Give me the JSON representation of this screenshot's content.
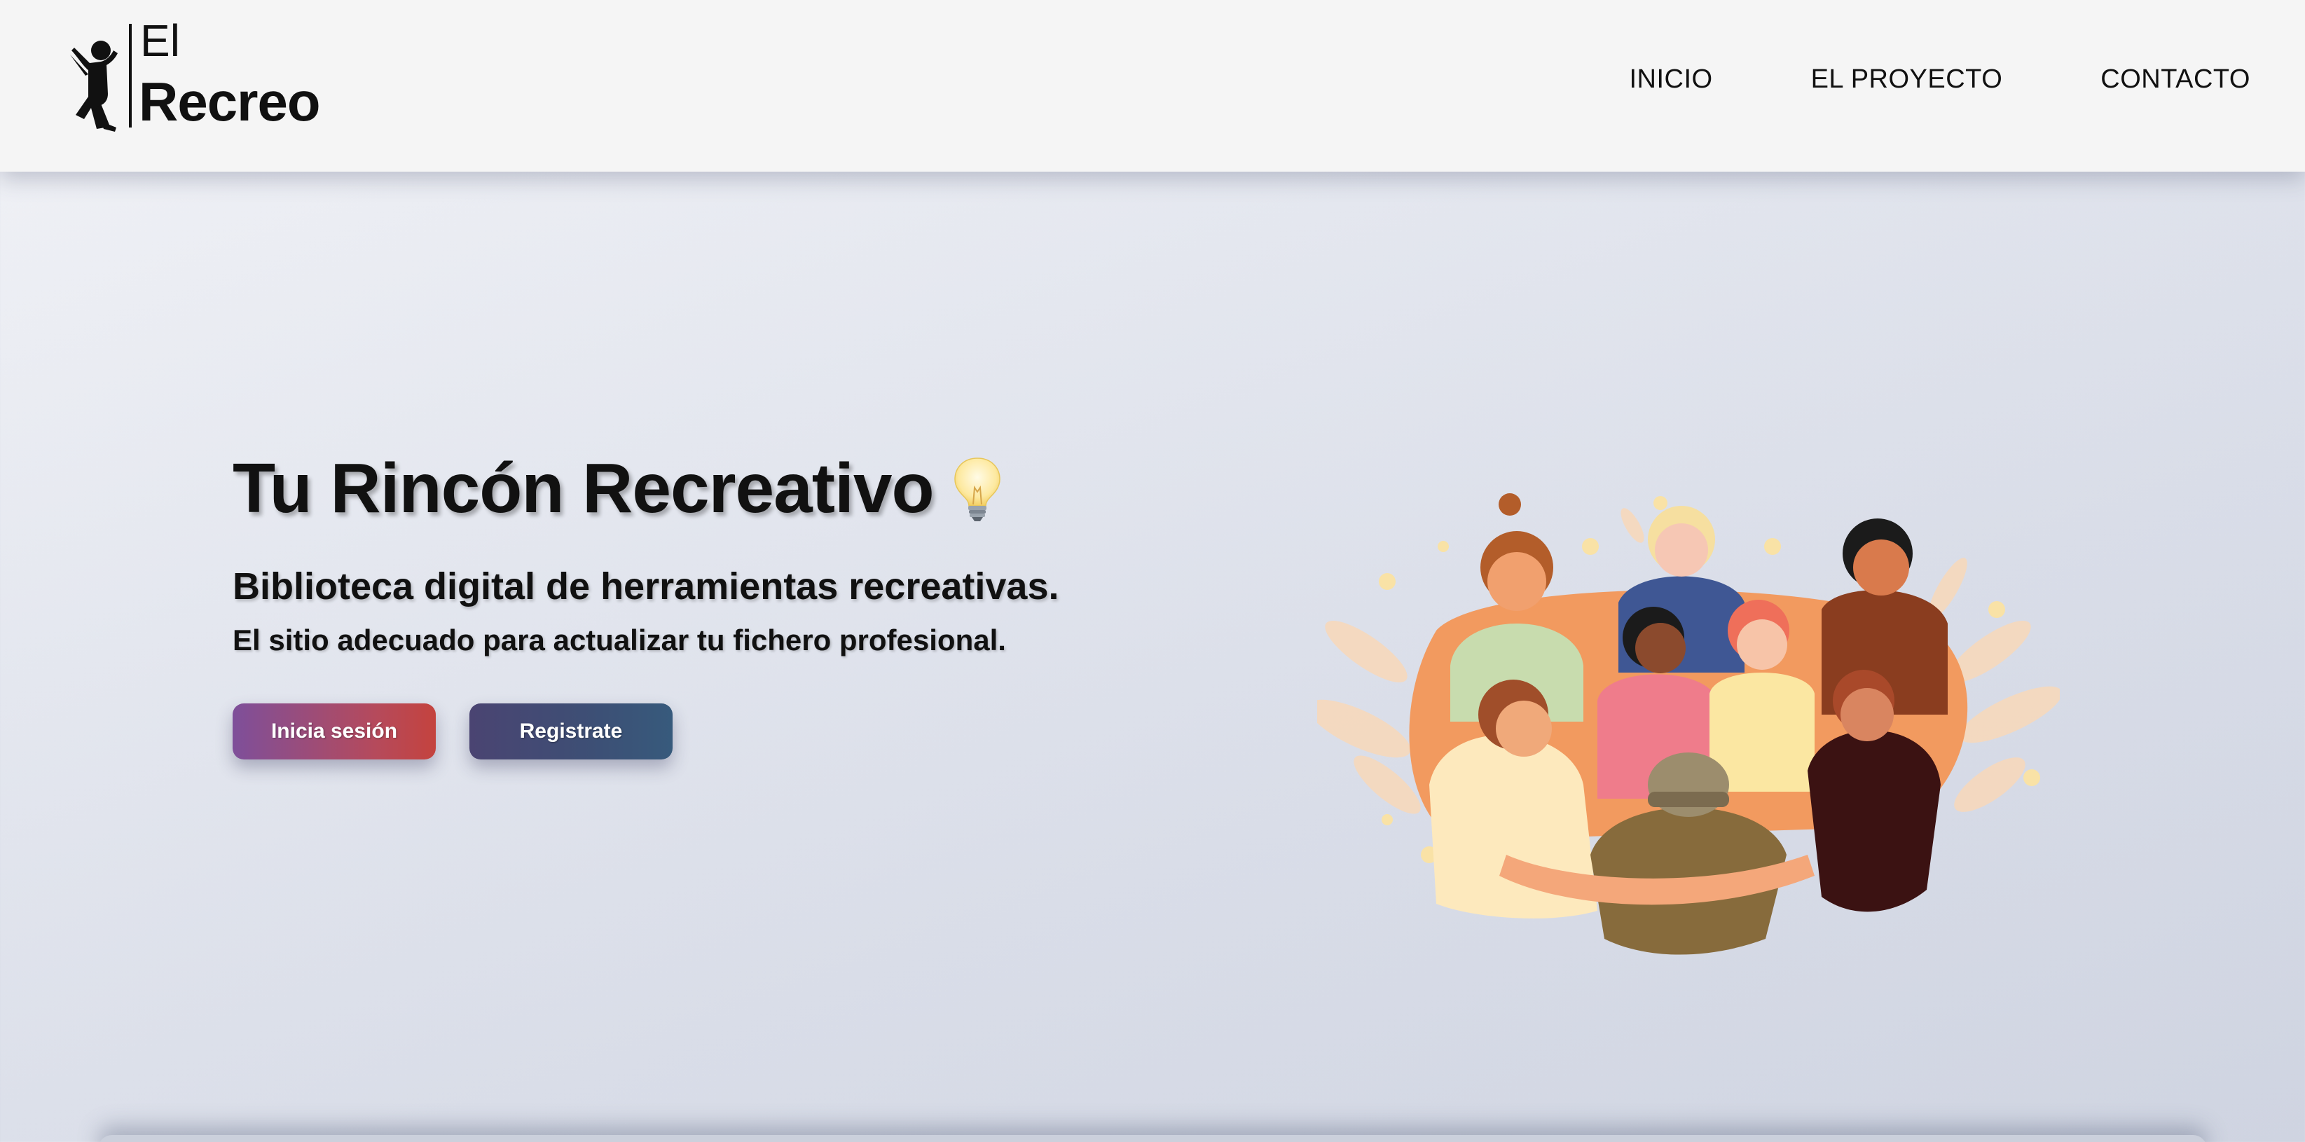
{
  "header": {
    "logo": {
      "line1": "El",
      "line2": "Recreo",
      "icon": "jumping-child-icon"
    },
    "nav": [
      {
        "label": "INICIO"
      },
      {
        "label": "EL PROYECTO"
      },
      {
        "label": "CONTACTO"
      }
    ]
  },
  "hero": {
    "title": "Tu Rincón Recreativo",
    "title_icon": "lightbulb-icon",
    "subtitle": "Biblioteca digital de herramientas recreativas.",
    "description": "El sitio adecuado para actualizar tu fichero profesional.",
    "buttons": {
      "login": "Inicia sesión",
      "register": "Registrate"
    },
    "illustration": "group-hug-illustration"
  },
  "colors": {
    "header_bg": "#f5f5f5",
    "login_gradient": [
      "#7e4f9a",
      "#c4433e"
    ],
    "register_gradient": [
      "#4a4472",
      "#375a7c"
    ],
    "text": "#111111"
  }
}
